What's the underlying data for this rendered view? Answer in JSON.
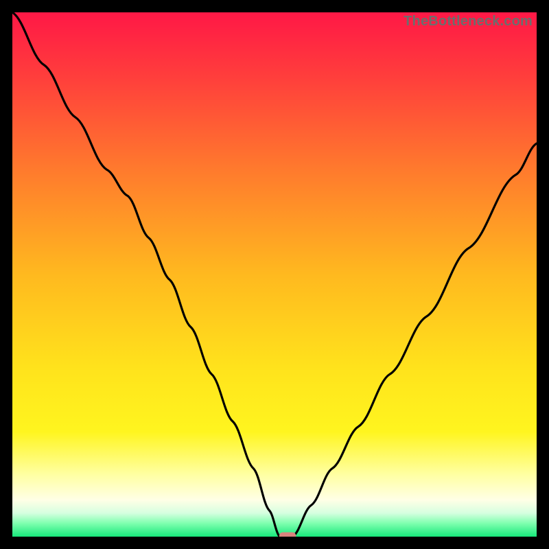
{
  "watermark": "TheBottleneck.com",
  "chart_data": {
    "type": "line",
    "title": "",
    "xlabel": "",
    "ylabel": "",
    "xlim": [
      0,
      100
    ],
    "ylim": [
      0,
      100
    ],
    "grid": false,
    "gradient_stops": [
      {
        "offset": 0.0,
        "color": "#ff1846"
      },
      {
        "offset": 0.12,
        "color": "#ff3d3c"
      },
      {
        "offset": 0.3,
        "color": "#ff7a2d"
      },
      {
        "offset": 0.5,
        "color": "#ffb91f"
      },
      {
        "offset": 0.68,
        "color": "#ffe31c"
      },
      {
        "offset": 0.8,
        "color": "#fff51f"
      },
      {
        "offset": 0.88,
        "color": "#ffffa0"
      },
      {
        "offset": 0.93,
        "color": "#ffffe6"
      },
      {
        "offset": 0.955,
        "color": "#d6ffe0"
      },
      {
        "offset": 0.975,
        "color": "#7dffae"
      },
      {
        "offset": 1.0,
        "color": "#17e87b"
      }
    ],
    "curve": {
      "note": "V-shaped bottleneck curve; x = relative component balance, y = bottleneck percentage (0 = no bottleneck)",
      "x": [
        0,
        6,
        12,
        18,
        22,
        26,
        30,
        34,
        38,
        42,
        46,
        49,
        51,
        53.5,
        57,
        61,
        66,
        72,
        79,
        87,
        96,
        100
      ],
      "y": [
        100,
        90,
        80,
        70,
        65,
        57,
        49,
        40,
        31,
        22,
        13,
        5,
        0,
        0,
        6,
        13,
        21,
        31,
        42,
        55,
        69,
        75
      ]
    },
    "marker": {
      "note": "Small rounded marker at the optimum (no-bottleneck) point",
      "x": 52.5,
      "y": 0,
      "width_frac": 0.032,
      "height_frac": 0.014,
      "color": "#d9837e"
    }
  }
}
